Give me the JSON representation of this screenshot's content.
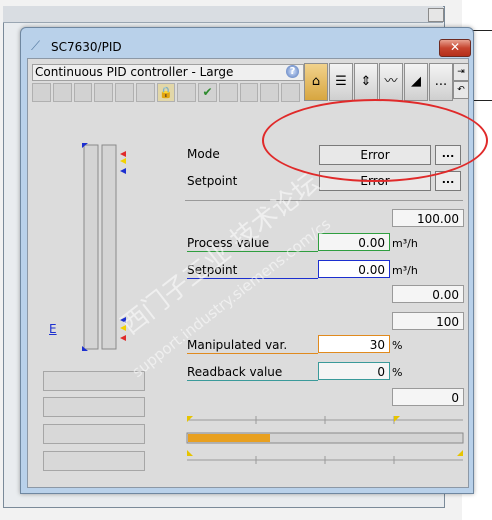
{
  "window": {
    "title": "SC7630/PID",
    "close_label": "✕"
  },
  "header": {
    "block_name": "Continuous PID controller - Large",
    "help_label": "?",
    "overflow_label": "..."
  },
  "mode": {
    "label": "Mode",
    "value": "Error",
    "dots": "..."
  },
  "setpoint_top": {
    "label": "Setpoint",
    "value": "Error",
    "dots": "..."
  },
  "scale": {
    "high": "100.00",
    "low": "0.00",
    "mv_high": "100",
    "mv_low": "0"
  },
  "process_value": {
    "label": "Process value",
    "value": "0.00",
    "unit": "m³/h"
  },
  "setpoint": {
    "label": "Setpoint",
    "value": "0.00",
    "unit": "m³/h"
  },
  "manipulated": {
    "label": "Manipulated var.",
    "value": "30",
    "unit": "%"
  },
  "readback": {
    "label": "Readback value",
    "value": "0",
    "unit": "%"
  },
  "bargraph": {
    "e_label": "E"
  },
  "output_bar": {
    "fill_fraction": 0.3
  },
  "watermark": {
    "line1": "西门子工业 技术论坛",
    "line2": "support.industry.siemens.com/cs"
  },
  "colors": {
    "pv": "#2f9e3f",
    "sp": "#1c2fd0",
    "mv": "#e08a1e",
    "rb": "#3a9a9a",
    "highlight": "#e02a2a"
  }
}
